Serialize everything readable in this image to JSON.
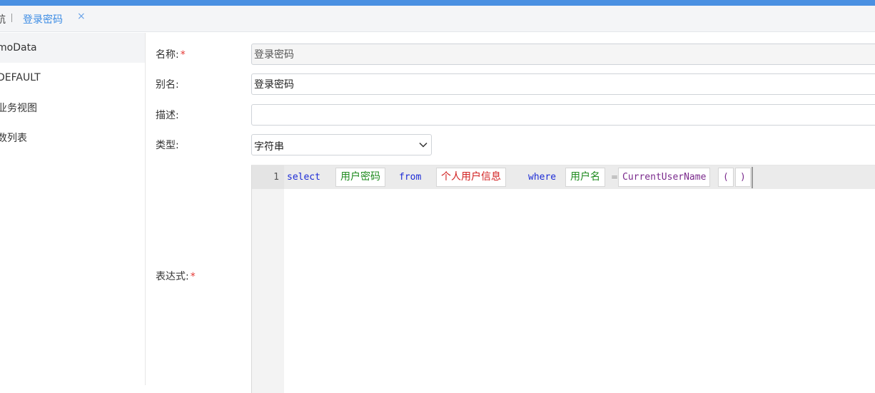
{
  "tabs": {
    "previous_label": "航",
    "active_label": "登录密码",
    "close_symbol": "×"
  },
  "sidebar": {
    "items": [
      {
        "label": "moData",
        "selected": true
      },
      {
        "label": "DEFAULT",
        "selected": false
      },
      {
        "label": "业务视图",
        "selected": false
      },
      {
        "label": "数列表",
        "selected": false
      }
    ]
  },
  "form": {
    "name_label": "名称:",
    "name_value": "登录密码",
    "alias_label": "别名:",
    "alias_value": "登录密码",
    "desc_label": "描述:",
    "desc_value": "",
    "type_label": "类型:",
    "type_value": "字符串",
    "expr_label": "表达式:",
    "required_mark": "*"
  },
  "editor": {
    "line_number": "1",
    "tokens": {
      "select": "select",
      "field": "用户密码",
      "from": "from",
      "table": "个人用户信息",
      "where": "where",
      "cond_field": "用户名",
      "eq": "=",
      "func": "CurrentUserName",
      "lparen": "(",
      "rparen": ")"
    }
  },
  "colors": {
    "accent": "#4a90e2",
    "keyword": "#1c2bd6",
    "field_chip": "#1e8a1e",
    "table_chip": "#d11f1f",
    "function_chip": "#7a2a8c",
    "required": "#e53935"
  }
}
